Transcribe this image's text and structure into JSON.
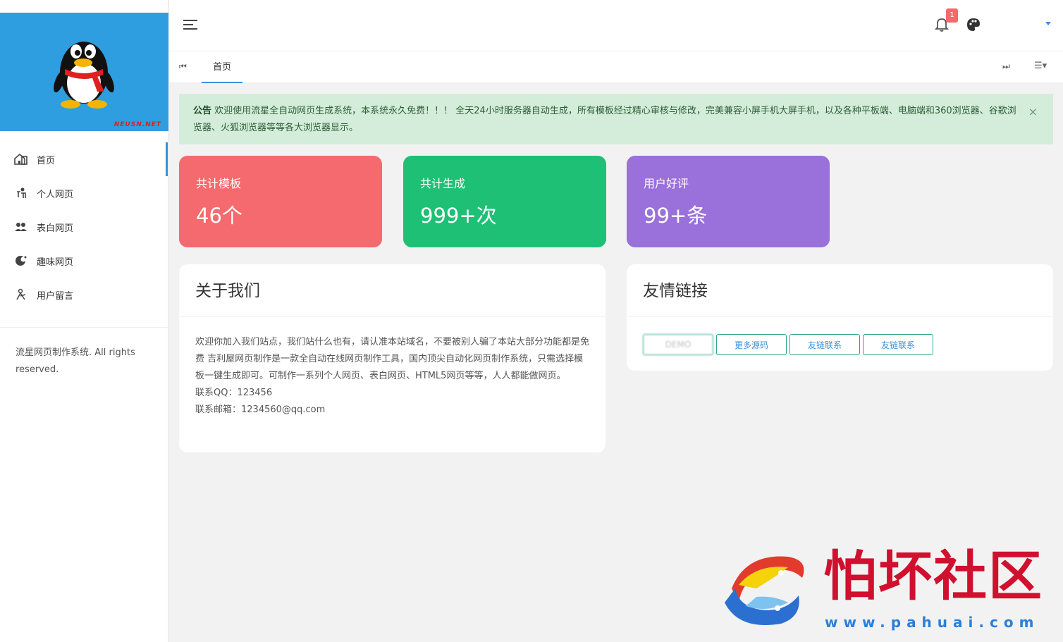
{
  "sidebar": {
    "logo_brand": "NEUSN.NET",
    "items": [
      {
        "label": "首页",
        "icon": "home-icon",
        "active": true
      },
      {
        "label": "个人网页",
        "icon": "person-icon",
        "active": false
      },
      {
        "label": "表白网页",
        "icon": "users-icon",
        "active": false
      },
      {
        "label": "趣味网页",
        "icon": "fun-icon",
        "active": false
      },
      {
        "label": "用户留言",
        "icon": "message-icon",
        "active": false
      }
    ],
    "copyright": "流星网页制作系统. All rights reserved."
  },
  "header": {
    "notification_count": "1"
  },
  "tabs": {
    "home": "首页"
  },
  "notice": {
    "label": "公告",
    "text": "欢迎使用流星全自动网页生成系统，本系统永久免费！！！ 全天24小时服务器自动生成，所有模板经过精心审核与修改，完美兼容小屏手机大屏手机，以及各种平板端、电脑端和360浏览器、谷歌浏览器、火狐浏览器等等各大浏览器显示。",
    "close": "×"
  },
  "stats": [
    {
      "label": "共计模板",
      "value": "46个",
      "color": "#f56a6e"
    },
    {
      "label": "共计生成",
      "value": "999+次",
      "color": "#1ec075"
    },
    {
      "label": "用户好评",
      "value": "99+条",
      "color": "#9a70da"
    }
  ],
  "about": {
    "title": "关于我们",
    "body": "欢迎你加入我们站点，我们站什么也有，请认准本站域名，不要被别人骗了本站大部分功能都是免费 吉利屋网页制作是一款全自动在线网页制作工具，国内顶尖自动化网页制作系统，只需选择模板一键生成即可。可制作一系列个人网页、表白网页、HTML5网页等等，人人都能做网页。",
    "qq": "联系QQ：123456",
    "email": "联系邮箱：1234560@qq.com"
  },
  "friends": {
    "title": "友情链接",
    "links": [
      "DEMO",
      "更多源码",
      "友链联系",
      "友链联系"
    ]
  },
  "watermark": {
    "text": "怕坏社区",
    "url": "www.pahuai.com"
  }
}
